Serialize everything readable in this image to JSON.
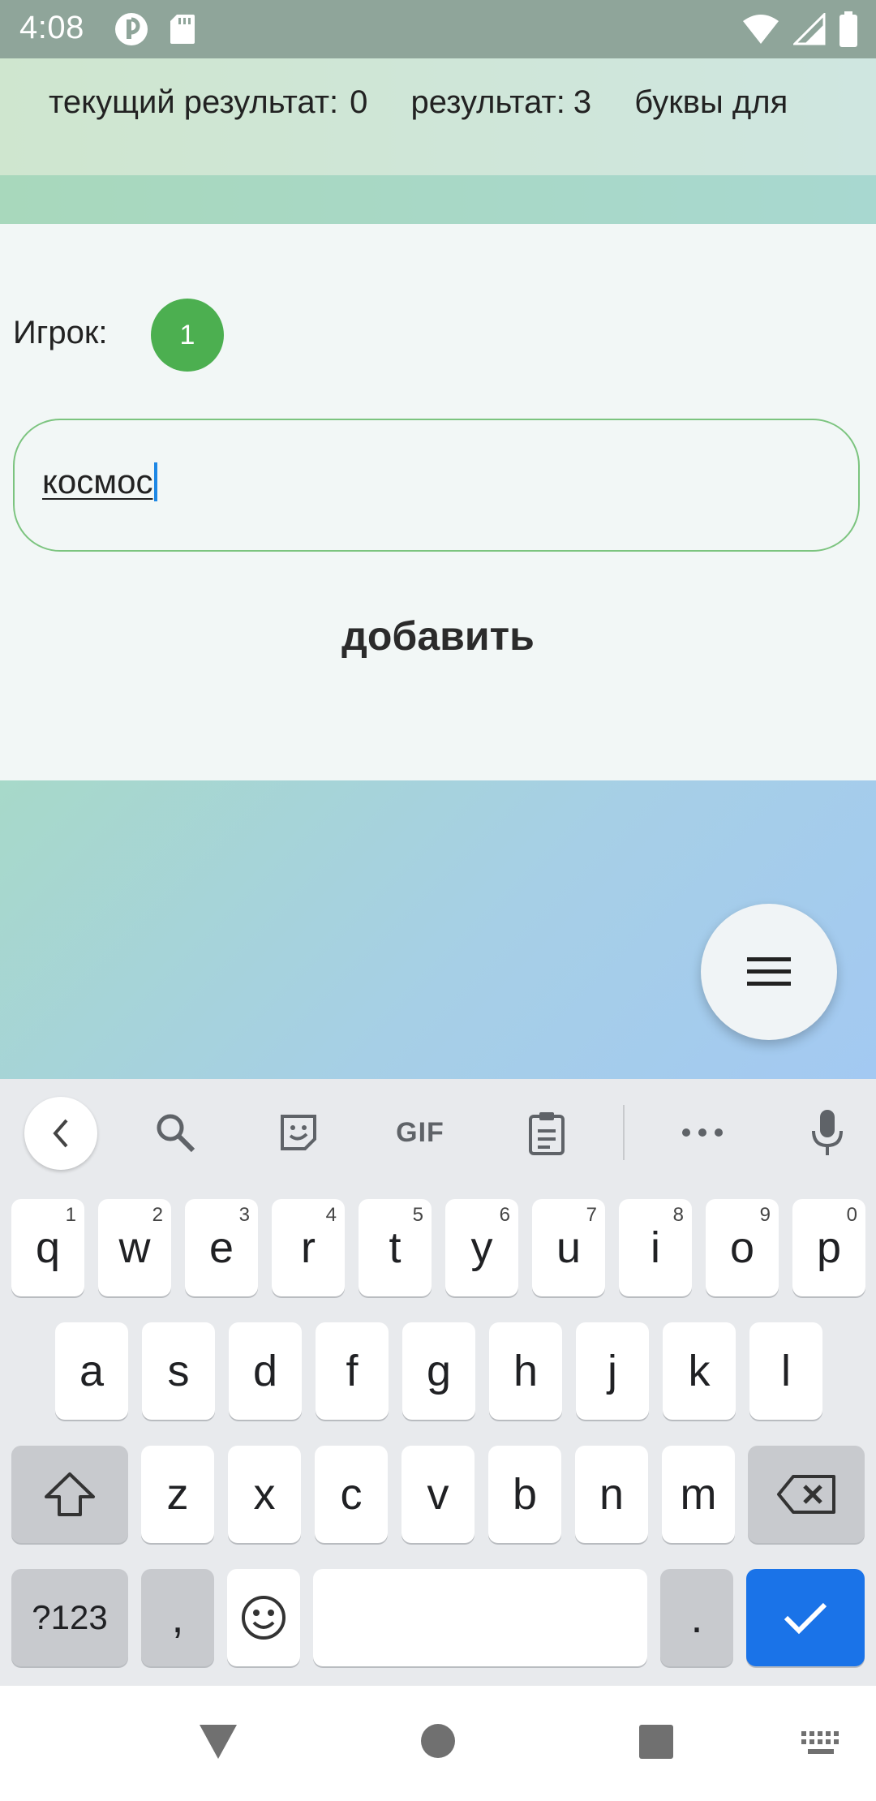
{
  "status_bar": {
    "time": "4:08"
  },
  "header": {
    "current_score_label": "текущий результат:",
    "current_score_value": "0",
    "total_score_label": "результат:",
    "total_score_value": "3",
    "letters_label": "буквы для"
  },
  "game": {
    "player_label": "Игрок:",
    "player_number": "1",
    "word_input_value": "космос",
    "add_button_label": "добавить"
  },
  "keyboard": {
    "toolbar": {
      "gif_label": "GIF"
    },
    "row1": [
      {
        "key": "q",
        "hint": "1"
      },
      {
        "key": "w",
        "hint": "2"
      },
      {
        "key": "e",
        "hint": "3"
      },
      {
        "key": "r",
        "hint": "4"
      },
      {
        "key": "t",
        "hint": "5"
      },
      {
        "key": "y",
        "hint": "6"
      },
      {
        "key": "u",
        "hint": "7"
      },
      {
        "key": "i",
        "hint": "8"
      },
      {
        "key": "o",
        "hint": "9"
      },
      {
        "key": "p",
        "hint": "0"
      }
    ],
    "row2": [
      "a",
      "s",
      "d",
      "f",
      "g",
      "h",
      "j",
      "k",
      "l"
    ],
    "row3": [
      "z",
      "x",
      "c",
      "v",
      "b",
      "n",
      "m"
    ],
    "symbols_label": "?123",
    "comma_label": ",",
    "period_label": "."
  }
}
